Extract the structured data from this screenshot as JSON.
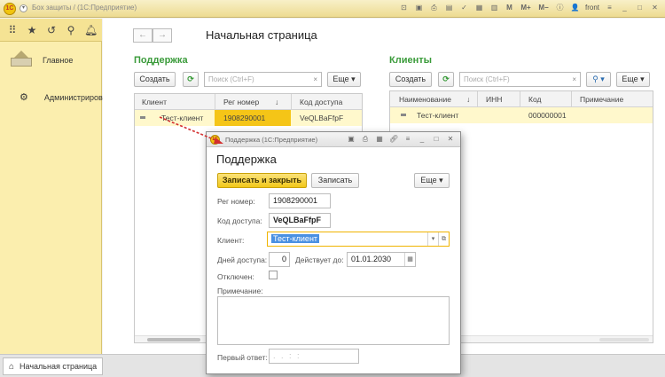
{
  "titlebar": {
    "title": "Бох защиты / (1С:Предприятие)",
    "logo_text": "1С",
    "user": "front",
    "icon_names": [
      "lock-icon",
      "save-icon",
      "print-icon",
      "preview-icon",
      "bookmark-icon",
      "calendar-icon",
      "table-icon",
      "memory-m-icon",
      "memory-mplus-icon",
      "memory-mminus-icon",
      "info-icon",
      "user-icon",
      "menu-icon",
      "minimize-icon",
      "maximize-icon",
      "close-icon"
    ]
  },
  "sidebar": {
    "items": [
      {
        "label": "Главное",
        "icon": "home-icon"
      },
      {
        "label": "Администрирование",
        "icon": "gear-icon"
      }
    ]
  },
  "main": {
    "page_title": "Начальная страница",
    "left": {
      "title": "Поддержка",
      "create_label": "Создать",
      "search_placeholder": "Поиск (Ctrl+F)",
      "more_label": "Еще",
      "columns": [
        "Клиент",
        "Рег номер",
        "Код доступа"
      ],
      "rows": [
        {
          "client": "Тест-клиент",
          "reg": "1908290001",
          "code": "VeQLBaFfpF"
        }
      ]
    },
    "right": {
      "title": "Клиенты",
      "create_label": "Создать",
      "search_placeholder": "Поиск (Ctrl+F)",
      "more_label": "Еще",
      "columns": [
        "Наименование",
        "ИНН",
        "Код",
        "Примечание"
      ],
      "rows": [
        {
          "name": "Тест-клиент",
          "inn": "",
          "code": "000000001",
          "note": ""
        }
      ]
    }
  },
  "bottom": {
    "tab_label": "Начальная страница"
  },
  "dialog": {
    "window_title": "Поддержка  (1С:Предприятие)",
    "logo_text": "1С",
    "heading": "Поддержка",
    "save_close_label": "Записать и закрыть",
    "save_label": "Записать",
    "more_label": "Еще",
    "reg_label": "Рег номер:",
    "reg_value": "1908290001",
    "code_label": "Код доступа:",
    "code_value": "VeQLBaFfpF",
    "client_label": "Клиент:",
    "client_value": "Тест-клиент",
    "days_label": "Дней доступа:",
    "days_value": "0",
    "valid_until_label": "Действует до:",
    "valid_until_value": "01.01.2030",
    "disabled_label": "Отключен:",
    "disabled_checked": false,
    "note_label": "Примечание:",
    "note_value": "",
    "first_answer_label": "Первый ответ:",
    "first_answer_value": ". .   : :"
  },
  "colors": {
    "accent_yellow": "#f2c819",
    "section_green": "#3a9b3a",
    "sidebar_bg": "#fbeeae",
    "selection_row": "#fff8cc",
    "arrow_red": "#d32f2f"
  }
}
